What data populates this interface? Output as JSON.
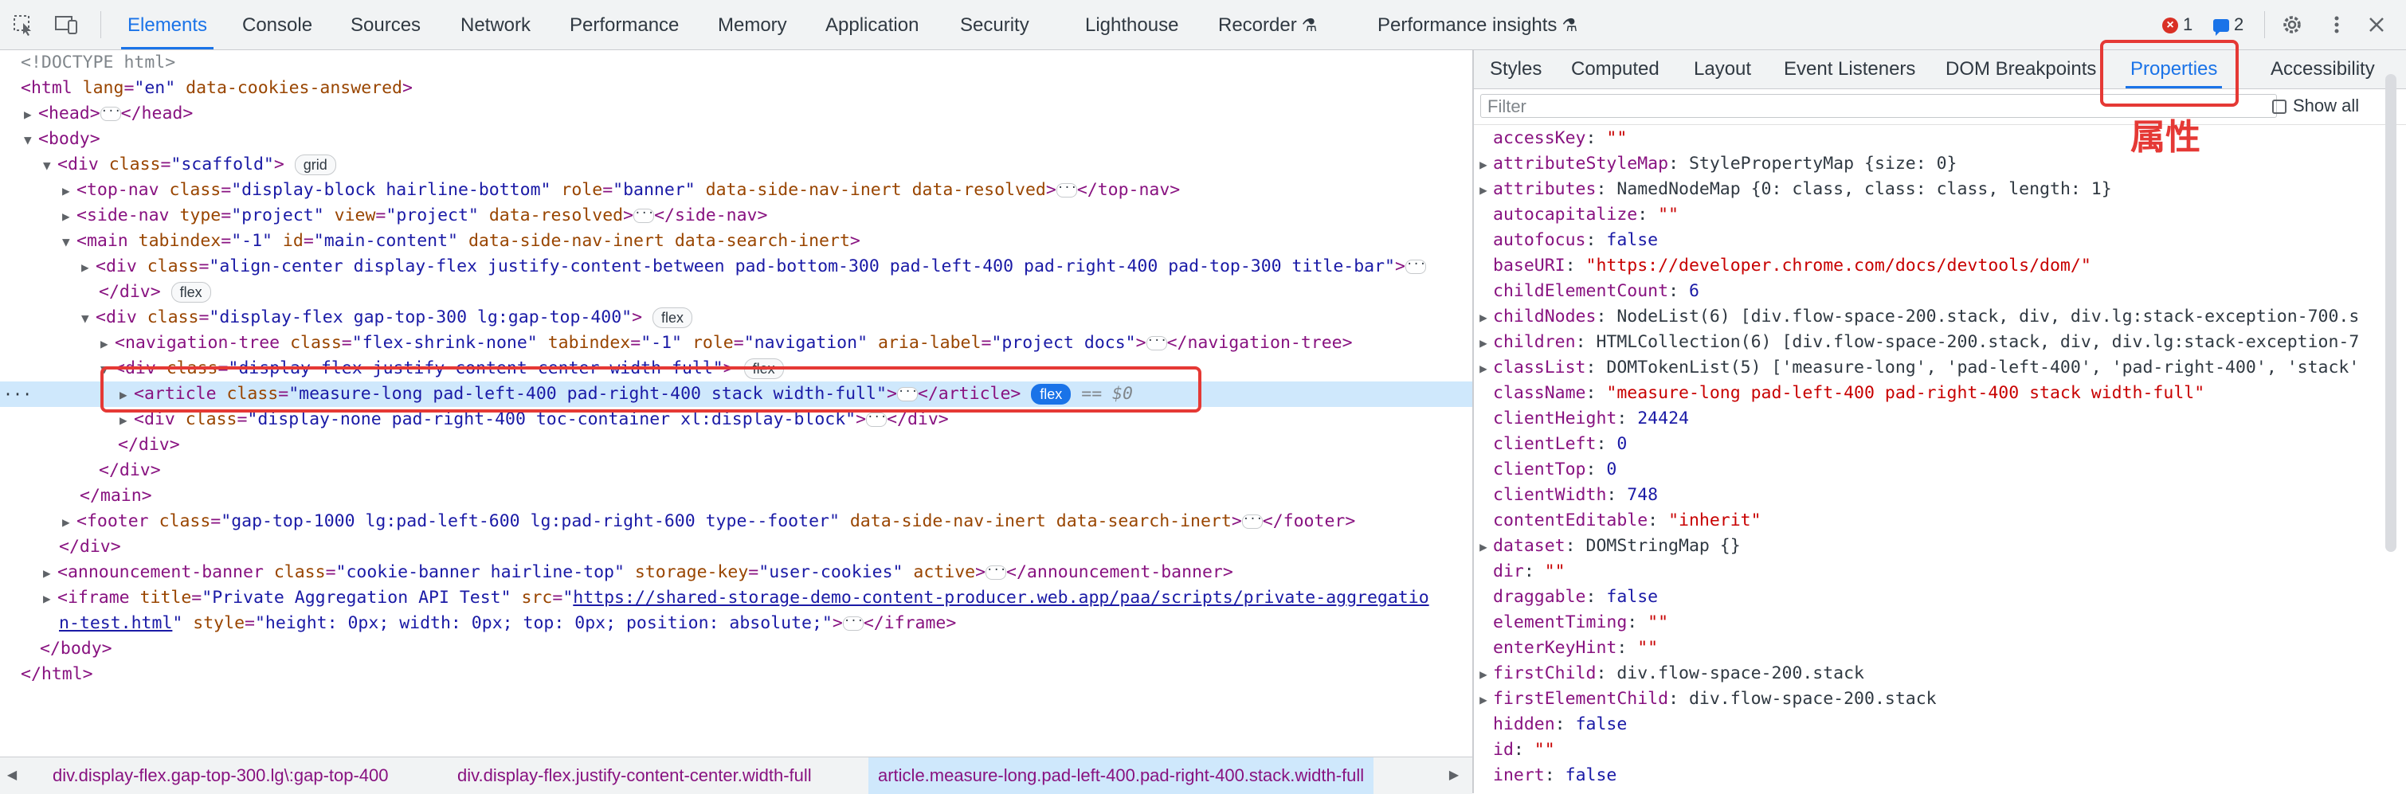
{
  "toolbar": {
    "tabs": [
      "Elements",
      "Console",
      "Sources",
      "Network",
      "Performance",
      "Memory",
      "Application",
      "Security",
      "Lighthouse",
      "Recorder",
      "Performance insights"
    ],
    "errors_count": "1",
    "messages_count": "2"
  },
  "dom_lines": [
    {
      "html": "<span class='g'>&lt;!DOCTYPE html&gt;</span>"
    },
    {
      "html": "&lt;html <span class='a'>lang</span>=<span class='v'>\"en\"</span> <span class='a'>data-cookies-answered</span>&gt;"
    },
    {
      "html": "<span class='tri'>▶</span>&lt;head&gt;<span class='dots'>···</span>&lt;/head&gt;"
    },
    {
      "html": "<span class='tri'>▼</span>&lt;body&gt;"
    },
    {
      "html": "<span class='tri'>▼</span>&lt;div <span class='a'>class</span>=<span class='v'>\"scaffold\"</span>&gt; <span class='pill'>grid</span>"
    },
    {
      "html": "<span class='tri'>▶</span>&lt;top-nav <span class='a'>class</span>=<span class='v'>\"display-block hairline-bottom\"</span> <span class='a'>role</span>=<span class='v'>\"banner\"</span> <span class='a'>data-side-nav-inert</span> <span class='a'>data-resolved</span>&gt;<span class='dots'>···</span>&lt;/top-nav&gt;"
    },
    {
      "html": "<span class='tri'>▶</span>&lt;side-nav <span class='a'>type</span>=<span class='v'>\"project\"</span> <span class='a'>view</span>=<span class='v'>\"project\"</span> <span class='a'>data-resolved</span>&gt;<span class='dots'>···</span>&lt;/side-nav&gt;"
    },
    {
      "html": "<span class='tri'>▼</span>&lt;main <span class='a'>tabindex</span>=<span class='v'>\"-1\"</span> <span class='a'>id</span>=<span class='v'>\"main-content\"</span> <span class='a'>data-side-nav-inert</span> <span class='a'>data-search-inert</span>&gt;"
    },
    {
      "html": "<span class='tri'>▶</span>&lt;div <span class='a'>class</span>=<span class='v'>\"align-center display-flex justify-content-between pad-bottom-300 pad-left-400 pad-right-400 pad-top-300 title-bar\"</span>&gt;<span class='dots'>···</span>"
    },
    {
      "html": "&lt;/div&gt; <span class='pill'>flex</span>"
    },
    {
      "html": "<span class='tri'>▼</span>&lt;div <span class='a'>class</span>=<span class='v'>\"display-flex gap-top-300 lg:gap-top-400\"</span>&gt; <span class='pill'>flex</span>"
    },
    {
      "html": "<span class='tri'>▶</span>&lt;navigation-tree <span class='a'>class</span>=<span class='v'>\"flex-shrink-none\"</span> <span class='a'>tabindex</span>=<span class='v'>\"-1\"</span> <span class='a'>role</span>=<span class='v'>\"navigation\"</span> <span class='a'>aria-label</span>=<span class='v'>\"project docs\"</span>&gt;<span class='dots'>···</span>&lt;/navigation-tree&gt;"
    },
    {
      "html": "<span class='tri'>▼</span>&lt;div <span class='a'>class</span>=<span class='v'>\"display-flex justify-content-center width-full\"</span>&gt; <span class='pill'>flex</span>"
    },
    {
      "html": "<span class='tri'>▶</span>&lt;article <span class='a'>class</span>=<span class='v'>\"measure-long pad-left-400 pad-right-400 stack width-full\"</span>&gt;<span class='dots'>···</span>&lt;/article&gt; <span class='pill blue'>flex</span> <span class='eq'>== $0</span>"
    },
    {
      "html": "<span class='tri'>▶</span>&lt;div <span class='a'>class</span>=<span class='v'>\"display-none pad-right-400 toc-container xl:display-block\"</span>&gt;<span class='dots'>···</span>&lt;/div&gt;"
    },
    {
      "html": "&lt;/div&gt;"
    },
    {
      "html": "&lt;/div&gt;"
    },
    {
      "html": "&lt;/main&gt;"
    },
    {
      "html": "<span class='tri'>▶</span>&lt;footer <span class='a'>class</span>=<span class='v'>\"gap-top-1000 lg:pad-left-600 lg:pad-right-600 type--footer\"</span> <span class='a'>data-side-nav-inert</span> <span class='a'>data-search-inert</span>&gt;<span class='dots'>···</span>&lt;/footer&gt;"
    },
    {
      "html": "&lt;/div&gt;"
    },
    {
      "html": "<span class='tri'>▶</span>&lt;announcement-banner <span class='a'>class</span>=<span class='v'>\"cookie-banner hairline-top\"</span> <span class='a'>storage-key</span>=<span class='v'>\"user-cookies\"</span> <span class='a'>active</span>&gt;<span class='dots'>···</span>&lt;/announcement-banner&gt;"
    },
    {
      "html": "<span class='tri'>▶</span>&lt;iframe <span class='a'>title</span>=<span class='v'>\"Private Aggregation API Test\"</span> <span class='a'>src</span>=<span class='v'>\"</span><span class='lnk'>https://shared-storage-demo-content-producer.web.app/paa/scripts/private-aggregatio</span>"
    },
    {
      "html": "<span class='lnk'>n-test.html</span><span class='v'>\"</span> <span class='a'>style</span>=<span class='v'>\"height: 0px; width: 0px; top: 0px; position: absolute;\"</span>&gt;<span class='dots'>···</span>&lt;/iframe&gt;"
    },
    {
      "html": "&lt;/body&gt;"
    },
    {
      "html": "&lt;/html&gt;"
    }
  ],
  "breadcrumbs": [
    "div.display-flex.gap-top-300.lg\\:gap-top-400",
    "div.display-flex.justify-content-center.width-full",
    "article.measure-long.pad-left-400.pad-right-400.stack.width-full"
  ],
  "side_tabs": [
    "Styles",
    "Computed",
    "Layout",
    "Event Listeners",
    "DOM Breakpoints",
    "Properties",
    "Accessibility"
  ],
  "filter": {
    "placeholder": "Filter",
    "show_all": "Show all"
  },
  "properties": [
    {
      "key": "accessKey",
      "val": "\"\"",
      "type": "s",
      "exp": false
    },
    {
      "key": "attributeStyleMap",
      "val": "StylePropertyMap {size: 0}",
      "type": "o",
      "exp": true
    },
    {
      "key": "attributes",
      "val": "NamedNodeMap {0: class, class: class, length: 1}",
      "type": "o",
      "exp": true
    },
    {
      "key": "autocapitalize",
      "val": "\"\"",
      "type": "s",
      "exp": false
    },
    {
      "key": "autofocus",
      "val": "false",
      "type": "n",
      "exp": false
    },
    {
      "key": "baseURI",
      "val": "\"https://developer.chrome.com/docs/devtools/dom/\"",
      "type": "s",
      "exp": false
    },
    {
      "key": "childElementCount",
      "val": "6",
      "type": "n",
      "exp": false
    },
    {
      "key": "childNodes",
      "val": "NodeList(6) [div.flow-space-200.stack, div, div.lg:stack-exception-700.s",
      "type": "o",
      "exp": true
    },
    {
      "key": "children",
      "val": "HTMLCollection(6) [div.flow-space-200.stack, div, div.lg:stack-exception-7",
      "type": "o",
      "exp": true
    },
    {
      "key": "classList",
      "val": "DOMTokenList(5) ['measure-long', 'pad-left-400', 'pad-right-400', 'stack'",
      "type": "o",
      "exp": true
    },
    {
      "key": "className",
      "val": "\"measure-long pad-left-400 pad-right-400 stack width-full\"",
      "type": "s",
      "exp": false
    },
    {
      "key": "clientHeight",
      "val": "24424",
      "type": "n",
      "exp": false
    },
    {
      "key": "clientLeft",
      "val": "0",
      "type": "n",
      "exp": false
    },
    {
      "key": "clientTop",
      "val": "0",
      "type": "n",
      "exp": false
    },
    {
      "key": "clientWidth",
      "val": "748",
      "type": "n",
      "exp": false
    },
    {
      "key": "contentEditable",
      "val": "\"inherit\"",
      "type": "s",
      "exp": false
    },
    {
      "key": "dataset",
      "val": "DOMStringMap {}",
      "type": "o",
      "exp": true
    },
    {
      "key": "dir",
      "val": "\"\"",
      "type": "s",
      "exp": false
    },
    {
      "key": "draggable",
      "val": "false",
      "type": "n",
      "exp": false
    },
    {
      "key": "elementTiming",
      "val": "\"\"",
      "type": "s",
      "exp": false
    },
    {
      "key": "enterKeyHint",
      "val": "\"\"",
      "type": "s",
      "exp": false
    },
    {
      "key": "firstChild",
      "val": "div.flow-space-200.stack",
      "type": "o",
      "exp": true
    },
    {
      "key": "firstElementChild",
      "val": "div.flow-space-200.stack",
      "type": "o",
      "exp": true
    },
    {
      "key": "hidden",
      "val": "false",
      "type": "n",
      "exp": false
    },
    {
      "key": "id",
      "val": "\"\"",
      "type": "s",
      "exp": false
    },
    {
      "key": "inert",
      "val": "false",
      "type": "n",
      "exp": false
    }
  ],
  "annotation_label": "属性",
  "colors": {
    "accent": "#1a73e8",
    "highlight": "#e53935",
    "selected_row": "#cfe8fc"
  }
}
